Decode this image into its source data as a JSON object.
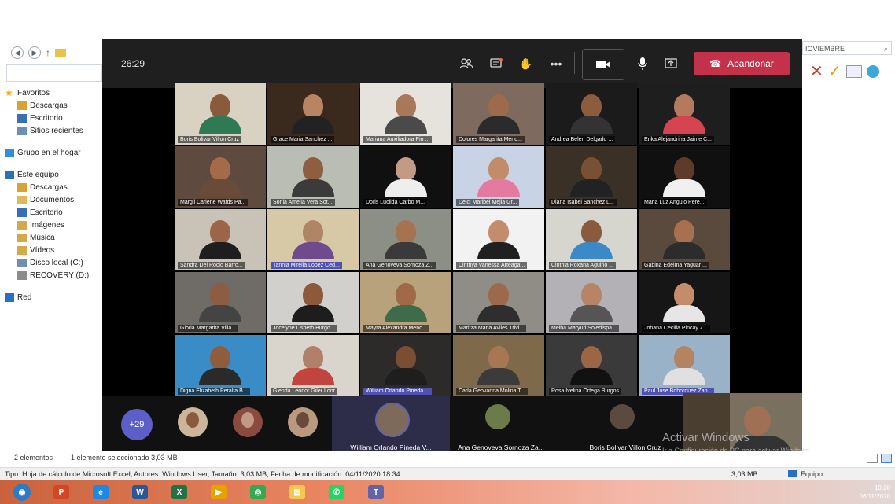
{
  "explorer": {
    "nav_arrows": {
      "back": "◀",
      "forward": "▶",
      "up": "↑"
    },
    "tree": [
      {
        "label": "Favoritos",
        "level": 0,
        "icon": "star-icon",
        "color": "#f2b21b"
      },
      {
        "label": "Descargas",
        "level": 1,
        "icon": "downloads-folder-icon",
        "color": "#d9a233"
      },
      {
        "label": "Escritorio",
        "level": 1,
        "icon": "desktop-folder-icon",
        "color": "#3a6fb8"
      },
      {
        "label": "Sitios recientes",
        "level": 1,
        "icon": "recent-places-icon",
        "color": "#6d8fb6"
      },
      {
        "label": "",
        "level": -1
      },
      {
        "label": "Grupo en el hogar",
        "level": 0,
        "icon": "homegroup-icon",
        "color": "#2f8fd8"
      },
      {
        "label": "",
        "level": -1
      },
      {
        "label": "Este equipo",
        "level": 0,
        "icon": "computer-icon",
        "color": "#2a6fc0"
      },
      {
        "label": "Descargas",
        "level": 1,
        "icon": "downloads-folder-icon",
        "color": "#d9a233"
      },
      {
        "label": "Documentos",
        "level": 1,
        "icon": "documents-folder-icon",
        "color": "#e0b85a"
      },
      {
        "label": "Escritorio",
        "level": 1,
        "icon": "desktop-folder-icon",
        "color": "#3a6fb8"
      },
      {
        "label": "Imágenes",
        "level": 1,
        "icon": "pictures-folder-icon",
        "color": "#d4a94a"
      },
      {
        "label": "Música",
        "level": 1,
        "icon": "music-folder-icon",
        "color": "#d4a94a"
      },
      {
        "label": "Vídeos",
        "level": 1,
        "icon": "videos-folder-icon",
        "color": "#d4a94a"
      },
      {
        "label": "Disco local (C:)",
        "level": 1,
        "icon": "local-disk-icon",
        "color": "#6d8fb6"
      },
      {
        "label": "RECOVERY (D:)",
        "level": 1,
        "icon": "drive-icon",
        "color": "#8c8c8c"
      },
      {
        "label": "",
        "level": -1
      },
      {
        "label": "Red",
        "level": 0,
        "icon": "network-icon",
        "color": "#2a6fc0"
      }
    ],
    "search_text": "IOVIEMBRE",
    "status_items": "2 elementos",
    "status_selected": "1 elemento seleccionado  3,03 MB",
    "details": "Tipo: Hoja de cálculo de Microsoft Excel, Autores: Windows User, Tamaño: 3,03 MB, Fecha de modificación: 04/11/2020 18:34",
    "details_size": "3,03 MB",
    "details_location": "Equipo"
  },
  "teams": {
    "timer": "26:29",
    "leave_label": "Abandonar",
    "participants": [
      {
        "name": "Boris Bolivar Villon Cruz",
        "bg": "#d9d2c3",
        "skin": "#8a5a3c",
        "shirt": "#2f7a55",
        "hl": false
      },
      {
        "name": "Grace Maria Sanchez ...",
        "bg": "#3a2a1e",
        "skin": "#b88464",
        "shirt": "#222222",
        "hl": false
      },
      {
        "name": "Mariana Auxiliadora Pin ...",
        "bg": "#e6e2dc",
        "skin": "#a9775a",
        "shirt": "#4a4a4a",
        "hl": false
      },
      {
        "name": "Dolores Margarita Mend...",
        "bg": "#7e6a5e",
        "skin": "#9c6b4c",
        "shirt": "#2b2b2b",
        "hl": false
      },
      {
        "name": "Andrea Belen Delgado ...",
        "bg": "#1b1b1b",
        "skin": "#8c5c3f",
        "shirt": "#333333",
        "hl": false
      },
      {
        "name": "Erika Alejandrina Jaime C...",
        "bg": "#1e1e1e",
        "skin": "#b57a5e",
        "shirt": "#d6454f",
        "hl": false
      },
      {
        "name": "Margil Carlene Wafds Pa...",
        "bg": "#5e4a3f",
        "skin": "#a36b4a",
        "shirt": "#6a4b3a",
        "hl": false
      },
      {
        "name": "Sonia Amelia Vera Sot...",
        "bg": "#b9bdb4",
        "skin": "#8f5e42",
        "shirt": "#3b3b3b",
        "hl": false
      },
      {
        "name": "Doris Lucilda Carbo M...",
        "bg": "#101010",
        "skin": "#c29a86",
        "shirt": "#eeeeee",
        "hl": false
      },
      {
        "name": "Deici Maribel Mejia Gr...",
        "bg": "#c8d4e6",
        "skin": "#c28c6a",
        "shirt": "#e57aa0",
        "hl": false
      },
      {
        "name": "Diana Isabel Sanchez L...",
        "bg": "#3b3026",
        "skin": "#7a5035",
        "shirt": "#222222",
        "hl": false
      },
      {
        "name": "Maria Luz Angulo Pere...",
        "bg": "#101010",
        "skin": "#5e3a2a",
        "shirt": "#f0f0f0",
        "hl": false
      },
      {
        "name": "Sandra Del Rocio Barro...",
        "bg": "#c9c2b6",
        "skin": "#9c6547",
        "shirt": "#1e1e1e",
        "hl": false
      },
      {
        "name": "Tannia Mirella Lopez Ced...",
        "bg": "#d8c9a6",
        "skin": "#b08566",
        "shirt": "#6f4a8c",
        "hl": true
      },
      {
        "name": "Ana Genoveva Sornoza Z...",
        "bg": "#8c8f86",
        "skin": "#a67351",
        "shirt": "#3a3a3a",
        "hl": false
      },
      {
        "name": "Cinthya Vanessa Arteaga...",
        "bg": "#f2f2f2",
        "skin": "#c48c6c",
        "shirt": "#202020",
        "hl": false
      },
      {
        "name": "Cinthia Roxana Aguiño ...",
        "bg": "#d6d6cf",
        "skin": "#8a5a3f",
        "shirt": "#3b89c6",
        "hl": false
      },
      {
        "name": "Gabina Edelma Yaguar ...",
        "bg": "#5a4a3e",
        "skin": "#a8704e",
        "shirt": "#2c2c2c",
        "hl": false
      },
      {
        "name": "Gloria Margarita Villa...",
        "bg": "#6f6b66",
        "skin": "#8e5c43",
        "shirt": "#444444",
        "hl": false
      },
      {
        "name": "Jocelyne Lisbeth Burgo...",
        "bg": "#d2d0cc",
        "skin": "#8c5a3b",
        "shirt": "#1d1d1d",
        "hl": false
      },
      {
        "name": "Mayra Alexandra Meno...",
        "bg": "#b8a27c",
        "skin": "#a06a48",
        "shirt": "#3e6c4a",
        "hl": false
      },
      {
        "name": "Maritza Maria Aviles Trivi...",
        "bg": "#8f8d86",
        "skin": "#9c6a4b",
        "shirt": "#2e2e2e",
        "hl": false
      },
      {
        "name": "Melba Maryuri Soledispa...",
        "bg": "#b3b1b6",
        "skin": "#b78466",
        "shirt": "#555555",
        "hl": false
      },
      {
        "name": "Johana Cecilia Pincay Z...",
        "bg": "#161616",
        "skin": "#c48c6a",
        "shirt": "#e6e6e6",
        "hl": false
      },
      {
        "name": "Digna Elizabeth Peralta B...",
        "bg": "#3a8cc6",
        "skin": "#8f5c3e",
        "shirt": "#2a2a2a",
        "hl": false
      },
      {
        "name": "Glenda Leonor Giler Loor",
        "bg": "#d9d4cc",
        "skin": "#b0806a",
        "shirt": "#c1443e",
        "hl": false
      },
      {
        "name": "William Orlando Pineda ...",
        "bg": "#2d2b2a",
        "skin": "#7a4e33",
        "shirt": "#1e1e1e",
        "hl": true
      },
      {
        "name": "Carla Geovanna Molina T...",
        "bg": "#7e6a4a",
        "skin": "#a87652",
        "shirt": "#3b3b3b",
        "hl": false
      },
      {
        "name": "Rosa Ivelina Ortega Burgos",
        "bg": "#3a3a3a",
        "skin": "#9a6646",
        "shirt": "#111111",
        "hl": false
      },
      {
        "name": "Paul Jose Bohorquez Zap...",
        "bg": "#9ab2c8",
        "skin": "#b38462",
        "shirt": "#e0e0e0",
        "hl": true
      }
    ],
    "more_count": "+29",
    "strip_avatars": [
      {
        "bg": "#cbb69a",
        "skin": "#8a5a3f"
      },
      {
        "bg": "#8b4a3e",
        "skin": "#c29886"
      },
      {
        "bg": "#b99a80",
        "skin": "#6a4a3a"
      }
    ],
    "strip_people": [
      {
        "name": "William Orlando Pineda V...",
        "speaking": true
      },
      {
        "name": "Ana Genoveva Sornoza Za...",
        "speaking": false
      },
      {
        "name": "Boris Bolivar Villon Cruz",
        "speaking": false
      }
    ]
  },
  "activation": {
    "line1": "Activar Windows",
    "line2": "Ir a Configuración de PC para activar Windows."
  },
  "taskbar": {
    "apps": [
      {
        "icon": "start-orb-icon",
        "color": "#2a7cc7",
        "glyph": "◉"
      },
      {
        "icon": "powerpoint-icon",
        "color": "#d24726",
        "glyph": "P"
      },
      {
        "icon": "internet-explorer-icon",
        "color": "#1e88e5",
        "glyph": "e"
      },
      {
        "icon": "word-icon",
        "color": "#2b579a",
        "glyph": "W"
      },
      {
        "icon": "excel-icon",
        "color": "#217346",
        "glyph": "X"
      },
      {
        "icon": "media-player-icon",
        "color": "#e8a200",
        "glyph": "▶"
      },
      {
        "icon": "chrome-icon",
        "color": "#34a853",
        "glyph": "◎"
      },
      {
        "icon": "file-explorer-icon",
        "color": "#f2c94c",
        "glyph": "▤"
      },
      {
        "icon": "whatsapp-icon",
        "color": "#25d366",
        "glyph": "✆"
      },
      {
        "icon": "teams-icon",
        "color": "#6264a7",
        "glyph": "T"
      }
    ],
    "time": "10:20",
    "date": "06/11/2020"
  }
}
